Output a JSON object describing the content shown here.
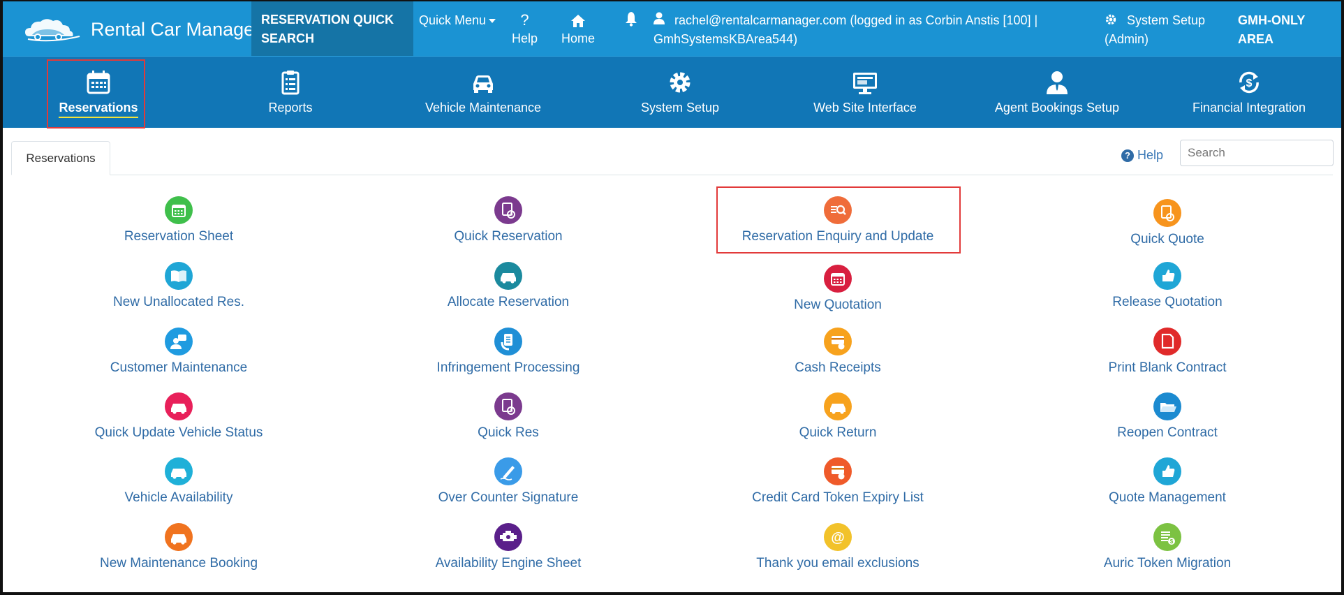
{
  "topbar": {
    "brand": "Rental Car Manager",
    "quick_search": "RESERVATION QUICK SEARCH",
    "quick_menu": "Quick Menu",
    "help": "Help",
    "home": "Home",
    "user_line1": "rachel@rentalcarmanager.com (logged in as Corbin Anstis [100] |",
    "user_line2": "GmhSystemsKBArea544)",
    "system_setup_line1": "System Setup",
    "system_setup_line2": "(Admin)",
    "gmh_line1": "GMH-ONLY",
    "gmh_line2": "AREA"
  },
  "nav": [
    {
      "label": "Reservations",
      "icon": "calendar-icon"
    },
    {
      "label": "Reports",
      "icon": "clipboard-icon"
    },
    {
      "label": "Vehicle Maintenance",
      "icon": "car-icon"
    },
    {
      "label": "System Setup",
      "icon": "gear-icon"
    },
    {
      "label": "Web Site Interface",
      "icon": "monitor-icon"
    },
    {
      "label": "Agent Bookings Setup",
      "icon": "agent-icon"
    },
    {
      "label": "Financial Integration",
      "icon": "dollar-sync-icon"
    }
  ],
  "tab": {
    "label": "Reservations"
  },
  "help_link": "Help",
  "search": {
    "placeholder": "Search",
    "value": ""
  },
  "tiles": [
    {
      "label": "Reservation Sheet",
      "color": "#3fbf4b"
    },
    {
      "label": "Quick Reservation",
      "color": "#7b3a8e"
    },
    {
      "label": "Reservation Enquiry and Update",
      "color": "#ef6c3a"
    },
    {
      "label": "Quick Quote",
      "color": "#f7941d"
    },
    {
      "label": "New Unallocated Res.",
      "color": "#1fa6d6"
    },
    {
      "label": "Allocate Reservation",
      "color": "#1b8a9e"
    },
    {
      "label": "New Quotation",
      "color": "#d81f3f"
    },
    {
      "label": "Release Quotation",
      "color": "#1fa6d6"
    },
    {
      "label": "Customer Maintenance",
      "color": "#1f9be0"
    },
    {
      "label": "Infringement Processing",
      "color": "#1f8fd6"
    },
    {
      "label": "Cash Receipts",
      "color": "#f7a21d"
    },
    {
      "label": "Print Blank Contract",
      "color": "#e02a2a"
    },
    {
      "label": "Quick Update Vehicle Status",
      "color": "#e8205a"
    },
    {
      "label": "Quick Res",
      "color": "#7b3a8e"
    },
    {
      "label": "Quick Return",
      "color": "#f7a21d"
    },
    {
      "label": "Reopen Contract",
      "color": "#1b8ad0"
    },
    {
      "label": "Vehicle Availability",
      "color": "#1fb0d8"
    },
    {
      "label": "Over Counter Signature",
      "color": "#3a9be8"
    },
    {
      "label": "Credit Card Token Expiry List",
      "color": "#ef5a2a"
    },
    {
      "label": "Quote Management",
      "color": "#1fa6d6"
    },
    {
      "label": "New Maintenance Booking",
      "color": "#f0731f"
    },
    {
      "label": "Availability Engine Sheet",
      "color": "#5a1f8a"
    },
    {
      "label": "Thank you email exclusions",
      "color": "#f2c22a"
    },
    {
      "label": "Auric Token Migration",
      "color": "#7cc242"
    }
  ]
}
